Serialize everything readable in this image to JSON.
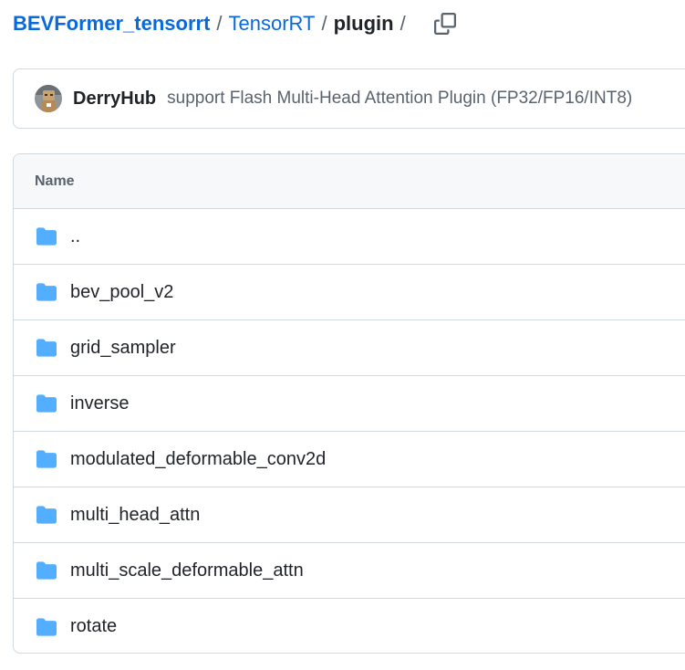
{
  "breadcrumb": {
    "repo": "BEVFormer_tensorrt",
    "separator": "/",
    "folder": "TensorRT",
    "current": "plugin",
    "copy_icon": "copy-icon"
  },
  "commit": {
    "author": "DerryHub",
    "message": "support Flash Multi-Head Attention Plugin (FP32/FP16/INT8)"
  },
  "table": {
    "header": "Name",
    "rows": [
      {
        "name": "..",
        "icon": "folder-icon"
      },
      {
        "name": "bev_pool_v2",
        "icon": "folder-icon"
      },
      {
        "name": "grid_sampler",
        "icon": "folder-icon"
      },
      {
        "name": "inverse",
        "icon": "folder-icon"
      },
      {
        "name": "modulated_deformable_conv2d",
        "icon": "folder-icon"
      },
      {
        "name": "multi_head_attn",
        "icon": "folder-icon"
      },
      {
        "name": "multi_scale_deformable_attn",
        "icon": "folder-icon"
      },
      {
        "name": "rotate",
        "icon": "folder-icon"
      }
    ]
  },
  "colors": {
    "link": "#0969da",
    "folder": "#54aeff",
    "border": "#d1d9e0",
    "header_bg": "#f6f8fa",
    "muted_text": "#59636e"
  }
}
